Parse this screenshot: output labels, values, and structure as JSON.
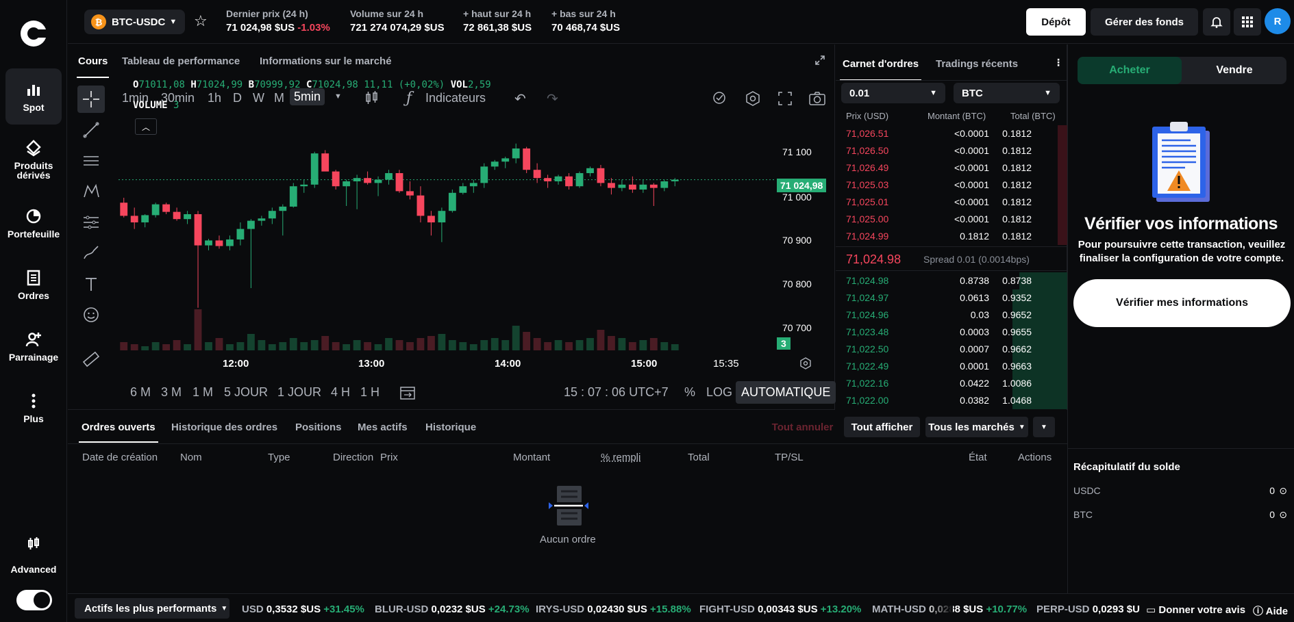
{
  "sidebar": {
    "items": [
      {
        "label": "Spot",
        "icon": "bar-chart-icon"
      },
      {
        "label": "Produits dérivés",
        "icon": "derivatives-icon"
      },
      {
        "label": "Portefeuille",
        "icon": "pie-chart-icon"
      },
      {
        "label": "Ordres",
        "icon": "document-icon"
      },
      {
        "label": "Parrainage",
        "icon": "add-user-icon"
      },
      {
        "label": "Plus",
        "icon": "more-icon"
      }
    ],
    "advanced_label": "Advanced"
  },
  "header": {
    "pair": "BTC-USDC",
    "pair_icon_letter": "₿",
    "stats": [
      {
        "label": "Dernier prix (24 h)",
        "value": "71 024,98 $US",
        "change": "-1.03%"
      },
      {
        "label": "Volume sur 24 h",
        "value": "721 274 074,29 $US"
      },
      {
        "label": "+ haut sur 24 h",
        "value": "72 861,38 $US"
      },
      {
        "label": "+ bas sur 24 h",
        "value": "70 468,74 $US"
      }
    ],
    "deposit_label": "Dépôt",
    "manage_label": "Gérer des fonds",
    "avatar_letter": "R"
  },
  "chart_tabs": [
    "Cours",
    "Tableau de performance",
    "Informations sur le marché"
  ],
  "chart_toolbar": {
    "timeframes": [
      "1min",
      "30min",
      "1h",
      "D",
      "W",
      "M",
      "5min"
    ],
    "indicators_label": "Indicateurs"
  },
  "ohlc": {
    "o_label": "O",
    "o": "71011,08",
    "h_label": "H",
    "h": "71024,99",
    "b_label": "B",
    "b": "70999,92",
    "c_label": "C",
    "c": "71024,98 11,11 (+0,02%)",
    "vol_label": "VOL",
    "vol": "2,59",
    "volume_label": "VOLUME",
    "volume": "3"
  },
  "chart_data": {
    "type": "candlestick",
    "x_ticks": [
      "12:00",
      "13:00",
      "14:00",
      "15:00",
      "15:35"
    ],
    "y_ticks": [
      "71 100",
      "71 000",
      "70 900",
      "70 800",
      "70 700"
    ],
    "ylim": [
      70650,
      71150
    ],
    "last_price": "71 024,98",
    "last_volume": "3",
    "candles": [
      [
        70960,
        70975,
        70915,
        70920
      ],
      [
        70920,
        70945,
        70880,
        70900
      ],
      [
        70900,
        70925,
        70885,
        70922
      ],
      [
        70922,
        70960,
        70915,
        70955
      ],
      [
        70955,
        70960,
        70925,
        70932
      ],
      [
        70932,
        70945,
        70905,
        70910
      ],
      [
        70910,
        70935,
        70895,
        70925
      ],
      [
        70925,
        70935,
        70640,
        70830
      ],
      [
        70830,
        70850,
        70815,
        70845
      ],
      [
        70845,
        70860,
        70820,
        70828
      ],
      [
        70828,
        70860,
        70815,
        70848
      ],
      [
        70848,
        70900,
        70830,
        70880
      ],
      [
        70880,
        70910,
        70700,
        70905
      ],
      [
        70905,
        70920,
        70890,
        70912
      ],
      [
        70912,
        70945,
        70895,
        70935
      ],
      [
        70935,
        70955,
        70860,
        70948
      ],
      [
        70948,
        71020,
        70945,
        71010
      ],
      [
        71010,
        71030,
        70990,
        71015
      ],
      [
        71015,
        71115,
        71005,
        71110
      ],
      [
        71110,
        71120,
        71060,
        71055
      ],
      [
        71055,
        71060,
        71000,
        71010
      ],
      [
        71010,
        71030,
        70950,
        71025
      ],
      [
        71025,
        71045,
        70940,
        71035
      ],
      [
        71035,
        71055,
        71015,
        71020
      ],
      [
        71020,
        71040,
        70980,
        71030
      ],
      [
        71030,
        71060,
        71015,
        71050
      ],
      [
        71050,
        71060,
        70990,
        70995
      ],
      [
        70995,
        71025,
        70970,
        70982
      ],
      [
        70982,
        71010,
        70900,
        70920
      ],
      [
        70920,
        70935,
        70860,
        70900
      ],
      [
        70900,
        70945,
        70840,
        70935
      ],
      [
        70935,
        71000,
        70930,
        70990
      ],
      [
        70990,
        71020,
        70985,
        71010
      ],
      [
        71010,
        71030,
        70990,
        71020
      ],
      [
        71020,
        71080,
        71005,
        71070
      ],
      [
        71070,
        71090,
        71060,
        71085
      ],
      [
        71085,
        71100,
        71065,
        71095
      ],
      [
        71095,
        71140,
        71080,
        71125
      ],
      [
        71125,
        71130,
        71050,
        71060
      ],
      [
        71060,
        71080,
        71020,
        71035
      ],
      [
        71035,
        71045,
        71005,
        71025
      ],
      [
        71025,
        71045,
        71015,
        71040
      ],
      [
        71040,
        71050,
        71000,
        71010
      ],
      [
        71010,
        71055,
        71005,
        71050
      ],
      [
        71050,
        71070,
        71040,
        71065
      ],
      [
        71065,
        71075,
        71010,
        71020
      ],
      [
        71020,
        71035,
        70985,
        71005
      ],
      [
        71005,
        71030,
        70995,
        71015
      ],
      [
        71015,
        71040,
        70990,
        71000
      ],
      [
        71000,
        71030,
        70990,
        71015
      ],
      [
        71015,
        71020,
        70950,
        71005
      ],
      [
        71005,
        71030,
        70995,
        71025
      ],
      [
        71025,
        71035,
        71010,
        71030
      ]
    ],
    "volumes": [
      4,
      3,
      2,
      4,
      3,
      5,
      3,
      20,
      4,
      6,
      3,
      4,
      8,
      5,
      3,
      4,
      6,
      4,
      5,
      7,
      4,
      3,
      5,
      4,
      3,
      6,
      5,
      4,
      6,
      7,
      8,
      5,
      4,
      3,
      5,
      6,
      5,
      12,
      9,
      6,
      4,
      5,
      4,
      5,
      6,
      10,
      7,
      6,
      4,
      5,
      6,
      4,
      3
    ]
  },
  "chart_ranges": {
    "items": [
      "6 M",
      "3 M",
      "1 M",
      "5 JOUR",
      "1 JOUR",
      "4 H",
      "1 H"
    ],
    "clock": "15 : 07 : 06 UTC+7",
    "percent_label": "%",
    "log_label": "LOG",
    "auto_label": "AUTOMATIQUE"
  },
  "orderbook": {
    "tabs": [
      "Carnet d'ordres",
      "Tradings récents"
    ],
    "tick_size": "0.01",
    "unit": "BTC",
    "headers": [
      "Prix (USD)",
      "Montant (BTC)",
      "Total (BTC)"
    ],
    "asks": [
      {
        "price": "71,026.51",
        "amount": "<0.0001",
        "total": "0.1812"
      },
      {
        "price": "71,026.50",
        "amount": "<0.0001",
        "total": "0.1812"
      },
      {
        "price": "71,026.49",
        "amount": "<0.0001",
        "total": "0.1812"
      },
      {
        "price": "71,025.03",
        "amount": "<0.0001",
        "total": "0.1812"
      },
      {
        "price": "71,025.01",
        "amount": "<0.0001",
        "total": "0.1812"
      },
      {
        "price": "71,025.00",
        "amount": "<0.0001",
        "total": "0.1812"
      },
      {
        "price": "71,024.99",
        "amount": "0.1812",
        "total": "0.1812"
      }
    ],
    "mid_price": "71,024.98",
    "spread": "Spread 0.01 (0.0014bps)",
    "bids": [
      {
        "price": "71,024.98",
        "amount": "0.8738",
        "total": "0.8738"
      },
      {
        "price": "71,024.97",
        "amount": "0.0613",
        "total": "0.9352"
      },
      {
        "price": "71,024.96",
        "amount": "0.03",
        "total": "0.9652"
      },
      {
        "price": "71,023.48",
        "amount": "0.0003",
        "total": "0.9655"
      },
      {
        "price": "71,022.50",
        "amount": "0.0007",
        "total": "0.9662"
      },
      {
        "price": "71,022.49",
        "amount": "0.0001",
        "total": "0.9663"
      },
      {
        "price": "71,022.16",
        "amount": "0.0422",
        "total": "1.0086"
      },
      {
        "price": "71,022.00",
        "amount": "0.0382",
        "total": "1.0468"
      }
    ]
  },
  "trade_panel": {
    "buy_label": "Acheter",
    "sell_label": "Vendre",
    "verify_title": "Vérifier vos informations",
    "verify_text": "Pour poursuivre cette transaction, veuillez finaliser la configuration de votre compte.",
    "verify_button": "Vérifier mes informations",
    "balance_title": "Récapitulatif du solde",
    "balances": [
      {
        "asset": "USDC",
        "amount": "0"
      },
      {
        "asset": "BTC",
        "amount": "0"
      }
    ]
  },
  "orders": {
    "tabs": [
      "Ordres ouverts",
      "Historique des ordres",
      "Positions",
      "Mes actifs",
      "Historique"
    ],
    "cancel_all": "Tout annuler",
    "show_all": "Tout afficher",
    "markets": "Tous les marchés",
    "columns": [
      "Date de création",
      "Nom",
      "Type",
      "Direction",
      "Prix",
      "Montant",
      "% rempli",
      "Total",
      "TP/SL",
      "État",
      "Actions"
    ],
    "empty": "Aucun ordre"
  },
  "ticker": {
    "selector": "Actifs les plus performants",
    "items": [
      {
        "sym": "USD",
        "price": "0,3532 $US",
        "pct": "+31.45%"
      },
      {
        "sym": "BLUR-USD",
        "price": "0,0232 $US",
        "pct": "+24.73%"
      },
      {
        "sym": "IRYS-USD",
        "price": "0,02430 $US",
        "pct": "+15.88%"
      },
      {
        "sym": "FIGHT-USD",
        "price": "0,00343 $US",
        "pct": "+13.20%"
      },
      {
        "sym": "MATH-USD",
        "price": "0,0288 $US",
        "pct": "+10.77%"
      },
      {
        "sym": "PERP-USD",
        "price": "0,0293 $U",
        "pct": ""
      }
    ],
    "feedback": "Donner votre avis",
    "help": "Aide"
  }
}
